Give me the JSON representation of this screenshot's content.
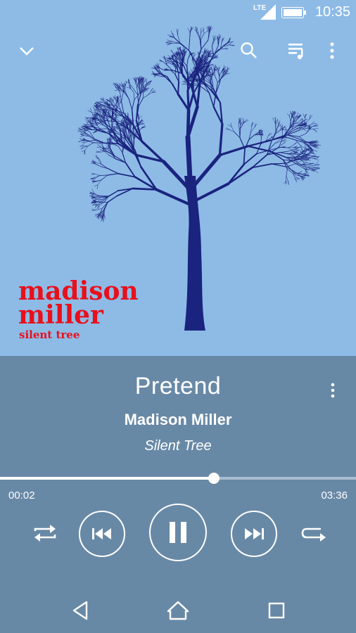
{
  "status": {
    "network": "LTE",
    "time": "10:35"
  },
  "album_art": {
    "artist_line1": "madison",
    "artist_line2": "miller",
    "album_line": "silent tree"
  },
  "track": {
    "title": "Pretend",
    "artist": "Madison Miller",
    "album": "Silent Tree"
  },
  "progress": {
    "elapsed": "00:02",
    "total": "03:36",
    "fraction": 0.6
  },
  "colors": {
    "art_bg": "#8dbbe6",
    "panel_bg": "#6889a6",
    "tree": "#1a237e",
    "album_red": "#e8101b"
  },
  "icons": [
    "collapse-chevron-icon",
    "search-icon",
    "queue-icon",
    "more-icon",
    "shuffle-icon",
    "previous-icon",
    "pause-icon",
    "next-icon",
    "repeat-icon",
    "nav-back-icon",
    "nav-home-icon",
    "nav-recents-icon"
  ]
}
